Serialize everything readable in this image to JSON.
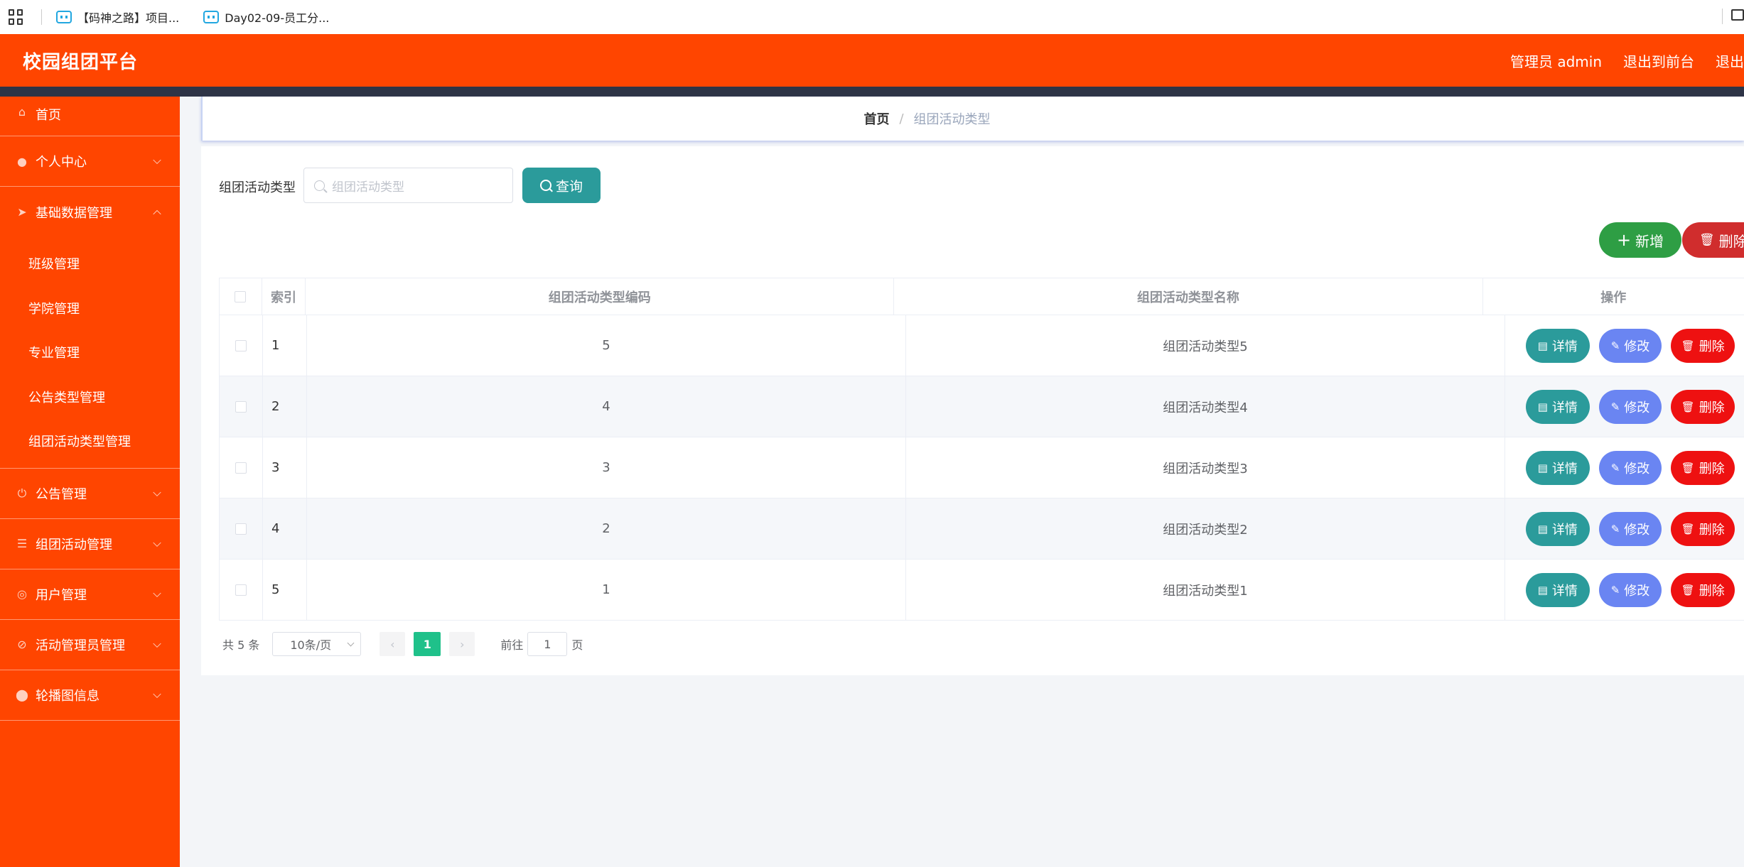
{
  "bookmarks": [
    {
      "label": "【码神之路】项目..."
    },
    {
      "label": "Day02-09-员工分..."
    }
  ],
  "header": {
    "title": "校园组团平台",
    "user_label": "管理员 admin",
    "to_front": "退出到前台",
    "logout": "退出"
  },
  "sidebar": {
    "home": "首页",
    "personal": "个人中心",
    "basic_data": "基础数据管理",
    "basic_sub": [
      "班级管理",
      "学院管理",
      "专业管理",
      "公告类型管理",
      "组团活动类型管理"
    ],
    "notice": "公告管理",
    "activity": "组团活动管理",
    "users": "用户管理",
    "activity_admin": "活动管理员管理",
    "carousel": "轮播图信息"
  },
  "breadcrumb": {
    "home": "首页",
    "separator": "/",
    "current": "组团活动类型"
  },
  "search": {
    "label": "组团活动类型",
    "placeholder": "组团活动类型",
    "button": "查询"
  },
  "actions": {
    "add": "新增",
    "batch_delete": "删除"
  },
  "table": {
    "headers": {
      "index": "索引",
      "code": "组团活动类型编码",
      "name": "组团活动类型名称",
      "ops": "操作"
    },
    "rows": [
      {
        "index": "1",
        "code": "5",
        "name": "组团活动类型5"
      },
      {
        "index": "2",
        "code": "4",
        "name": "组团活动类型4"
      },
      {
        "index": "3",
        "code": "3",
        "name": "组团活动类型3"
      },
      {
        "index": "4",
        "code": "2",
        "name": "组团活动类型2"
      },
      {
        "index": "5",
        "code": "1",
        "name": "组团活动类型1"
      }
    ],
    "op_labels": {
      "detail": "详情",
      "edit": "修改",
      "delete": "删除"
    }
  },
  "pagination": {
    "total": "共 5 条",
    "page_size": "10条/页",
    "current_page": "1",
    "goto_label": "前往",
    "goto_value": "1",
    "page_suffix": "页"
  },
  "colors": {
    "brand": "#ff4500",
    "teal": "#2b9b9b",
    "green": "#2e9e44",
    "edit": "#6a85f2",
    "danger": "#ee1111",
    "pager_active": "#1fc18a"
  }
}
